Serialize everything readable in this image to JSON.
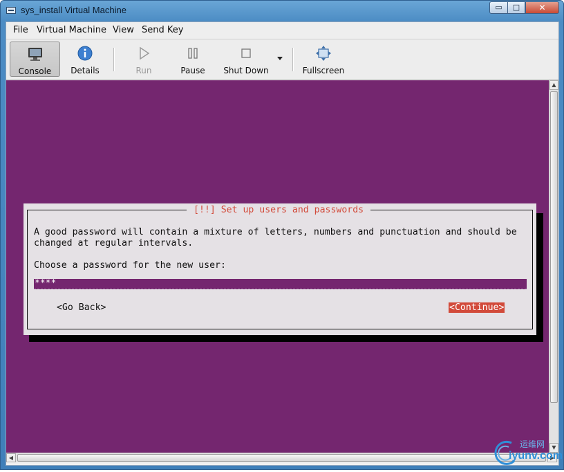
{
  "window": {
    "title": "sys_install Virtual Machine",
    "controls": {
      "minimize": "▭",
      "maximize": "□",
      "close": "✕"
    }
  },
  "menubar": {
    "items": [
      "File",
      "Virtual Machine",
      "View",
      "Send Key"
    ]
  },
  "toolbar": {
    "console": "Console",
    "details": "Details",
    "run": "Run",
    "pause": "Pause",
    "shutdown": "Shut Down",
    "fullscreen": "Fullscreen"
  },
  "installer": {
    "title": "[!!] Set up users and passwords",
    "line1": "A good password will contain a mixture of letters, numbers and punctuation and should be",
    "line2": "changed at regular intervals.",
    "prompt": "Choose a password for the new user:",
    "password_value": "****",
    "back_label": "<Go Back>",
    "continue_label": "<Continue>"
  },
  "watermark": {
    "cn": "运维网",
    "text": "iyunv.com"
  },
  "colors": {
    "console_bg": "#74266f",
    "accent_red": "#d24a3a",
    "dialog_bg": "#e5e1e5"
  },
  "icons": [
    "monitor-icon",
    "info-icon",
    "play-icon",
    "pause-icon",
    "stop-icon",
    "dropdown-arrow-icon",
    "fullscreen-icon"
  ]
}
